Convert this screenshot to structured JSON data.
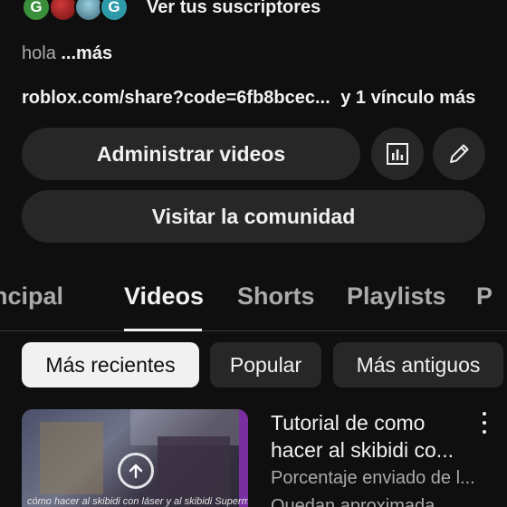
{
  "channel": {
    "subscribers_link": "Ver tus suscriptores",
    "subscriber_avatars": [
      "G",
      "",
      "",
      "G"
    ],
    "description": "hola",
    "description_more": "...más",
    "links_text": "roblox.com/share?code=6fb8bcec...",
    "links_more": "y 1 vínculo más"
  },
  "actions": {
    "manage_videos": "Administrar videos",
    "analytics_icon": "bar-chart-icon",
    "edit_icon": "pencil-icon",
    "visit_community": "Visitar la comunidad"
  },
  "tabs": [
    {
      "label": "ncipal"
    },
    {
      "label": "Videos",
      "selected": true
    },
    {
      "label": "Shorts"
    },
    {
      "label": "Playlists"
    },
    {
      "label": "P"
    }
  ],
  "filters": [
    {
      "label": "Más recientes",
      "selected": true
    },
    {
      "label": "Popular"
    },
    {
      "label": "Más antiguos"
    }
  ],
  "video": {
    "thumbnail_caption": "cómo hacer al skibidi con láser y al skibidi Superman",
    "title": "Tutorial de como hacer al skibidi co...",
    "status": "Porcentaje enviado de l...",
    "status2": "Quedan aproximada..."
  },
  "colors": {
    "background": "#0f0f0f",
    "button_bg": "#272727",
    "chip_selected_bg": "#f1f1f1",
    "text_primary": "#f1f1f1",
    "text_secondary": "#aaaaaa"
  }
}
